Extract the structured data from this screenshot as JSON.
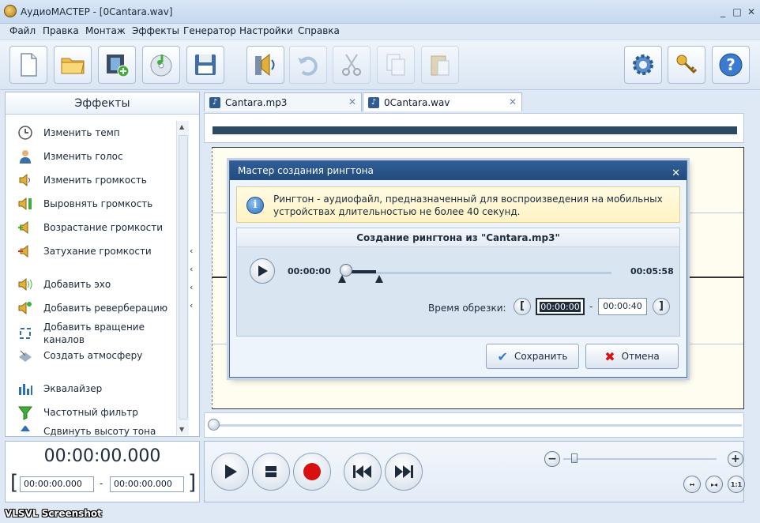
{
  "window": {
    "title": "АудиоМАСТЕР - [0Cantara.wav]",
    "controls": {
      "minimize": "_",
      "maximize": "□",
      "close": "✕"
    }
  },
  "menu": [
    "Файл",
    "Правка",
    "Монтаж",
    "Эффекты",
    "Генератор",
    "Настройки",
    "Справка"
  ],
  "toolbar": {
    "buttons": [
      {
        "name": "new-file",
        "icon": "new-file-icon",
        "enabled": true
      },
      {
        "name": "open-folder",
        "icon": "folder-icon",
        "enabled": true
      },
      {
        "name": "video-import",
        "icon": "film-icon",
        "enabled": true
      },
      {
        "name": "cd-rip",
        "icon": "cd-icon",
        "enabled": true
      },
      {
        "name": "save",
        "icon": "floppy-icon",
        "enabled": true
      },
      {
        "name": "ringtone",
        "icon": "speaker-icon",
        "enabled": true
      },
      {
        "name": "undo",
        "icon": "undo-icon",
        "enabled": false
      },
      {
        "name": "cut",
        "icon": "scissors-icon",
        "enabled": false
      },
      {
        "name": "copy",
        "icon": "copy-icon",
        "enabled": false
      },
      {
        "name": "paste",
        "icon": "paste-icon",
        "enabled": false
      },
      {
        "name": "settings",
        "icon": "gear-icon",
        "enabled": true
      },
      {
        "name": "keys",
        "icon": "keys-icon",
        "enabled": true
      },
      {
        "name": "help",
        "icon": "help-icon",
        "enabled": true
      }
    ]
  },
  "effects": {
    "header": "Эффекты",
    "items": [
      {
        "label": "Изменить темп",
        "icon": "clock-icon"
      },
      {
        "label": "Изменить голос",
        "icon": "person-icon"
      },
      {
        "label": "Изменить громкость",
        "icon": "volume-icon"
      },
      {
        "label": "Выровнять громкость",
        "icon": "level-volume-icon"
      },
      {
        "label": "Возрастание громкости",
        "icon": "fade-in-icon"
      },
      {
        "label": "Затухание громкости",
        "icon": "fade-out-icon"
      },
      {
        "label": "Добавить эхо",
        "icon": "echo-icon"
      },
      {
        "label": "Добавить реверберацию",
        "icon": "reverb-icon"
      },
      {
        "label": "Добавить вращение каналов",
        "icon": "rotate-channels-icon"
      },
      {
        "label": "Создать атмосферу",
        "icon": "atmosphere-icon"
      },
      {
        "label": "Эквалайзер",
        "icon": "equalizer-icon"
      },
      {
        "label": "Частотный фильтр",
        "icon": "filter-icon"
      },
      {
        "label": "Сдвинуть высоту тона",
        "icon": "pitch-icon"
      }
    ]
  },
  "tabs": [
    {
      "label": "Cantara.mp3",
      "active": false
    },
    {
      "label": "0Cantara.wav",
      "active": true
    }
  ],
  "time": {
    "current": "00:00:00.000",
    "sel_start": "00:00:00.000",
    "sel_dash": "-",
    "sel_end": "00:00:00.000"
  },
  "watermark": "VLSVL Screenshot",
  "dialog": {
    "title": "Мастер создания рингтона",
    "info": "Рингтон - аудиофайл, предназначенный для воспроизведения на мобильных устройствах длительностью не более 40 секунд.",
    "panel_title": "Создание рингтона из \"Cantara.mp3\"",
    "start_time": "00:00:00",
    "end_time": "00:05:58",
    "playhead_fraction": 0.0,
    "trim_label": "Время обрезки:",
    "trim_start": "00:00:00",
    "trim_dash": "-",
    "trim_end": "00:00:40",
    "save_label": "Сохранить",
    "cancel_label": "Отмена"
  },
  "colors": {
    "accent": "#2f5e97",
    "record": "#d81010",
    "info_bg": "#fff6cf"
  }
}
